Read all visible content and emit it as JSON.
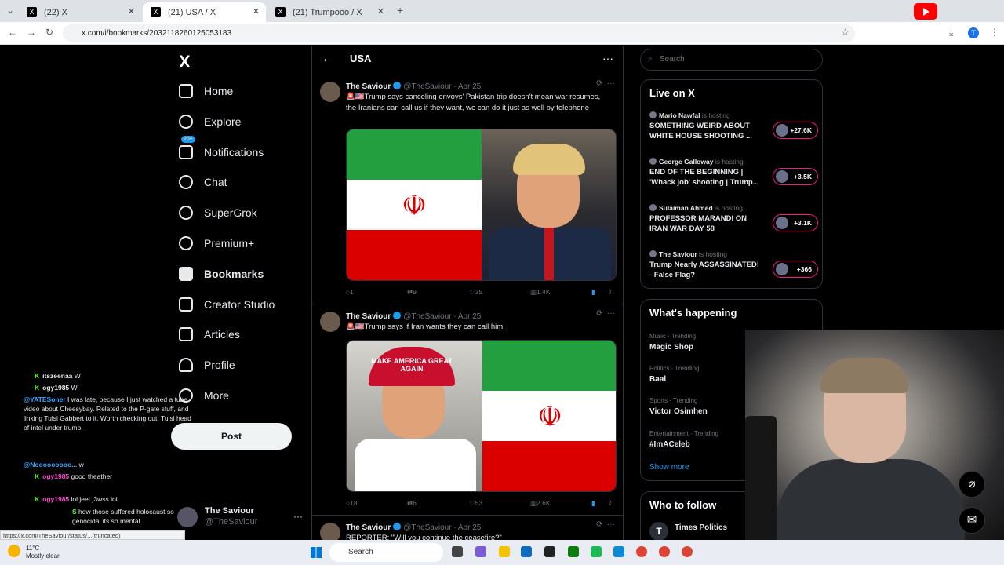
{
  "browser": {
    "tabs": [
      {
        "title": "(22) X"
      },
      {
        "title": "(21) USA / X"
      },
      {
        "title": "(21) Trumpooo / X"
      }
    ],
    "url": "x.com/i/bookmarks/2032118260125053183",
    "status_url": "https://x.com/TheSaviour/status/...(truncated)"
  },
  "sidebar": {
    "logo": "X",
    "items": [
      {
        "label": "Home"
      },
      {
        "label": "Explore"
      },
      {
        "label": "Notifications",
        "badge": "20+"
      },
      {
        "label": "Chat"
      },
      {
        "label": "SuperGrok"
      },
      {
        "label": "Premium+"
      },
      {
        "label": "Bookmarks"
      },
      {
        "label": "Creator Studio"
      },
      {
        "label": "Articles"
      },
      {
        "label": "Profile"
      },
      {
        "label": "More"
      }
    ],
    "post_label": "Post",
    "account": {
      "name": "The Saviour",
      "handle": "@TheSaviour"
    }
  },
  "feed": {
    "title": "USA",
    "tweets": [
      {
        "name": "The Saviour",
        "handle": "@TheSaviour",
        "date": "Apr 25",
        "text": "🚨🇺🇸Trump says canceling envoys' Pakistan trip doesn't mean war resumes, the Iranians can call us if they want, we can do it just as well by telephone",
        "replies": "1",
        "reposts": "9",
        "likes": "35",
        "views": "1.4K"
      },
      {
        "name": "The Saviour",
        "handle": "@TheSaviour",
        "date": "Apr 25",
        "text": "🚨🇺🇸Trump says if Iran wants they can call him.",
        "cap_text": "MAKE AMERICA GREAT AGAIN",
        "replies": "18",
        "reposts": "6",
        "likes": "53",
        "views": "2.6K"
      },
      {
        "name": "The Saviour",
        "handle": "@TheSaviour",
        "date": "Apr 25",
        "text": "REPORTER: \"Will you continue the ceasefire?\""
      }
    ]
  },
  "right": {
    "search_placeholder": "Search",
    "live_title": "Live on X",
    "hosting_label": "is hosting",
    "live": [
      {
        "host": "Mario Nawfal",
        "title": "SOMETHING WEIRD ABOUT WHITE HOUSE SHOOTING ...",
        "count": "+27.6K"
      },
      {
        "host": "George Galloway",
        "title": "END OF THE BEGINNING | 'Whack job' shooting | Trump...",
        "count": "+3.5K"
      },
      {
        "host": "Sulaiman Ahmed",
        "title": "PROFESSOR MARANDI ON IRAN WAR DAY 58",
        "count": "+3.1K"
      },
      {
        "host": "The Saviour",
        "title": "Trump Nearly ASSASSINATED! - False Flag?",
        "count": "+366"
      }
    ],
    "happening_title": "What's happening",
    "trends": [
      {
        "category": "Music · Trending",
        "name": "Magic Shop"
      },
      {
        "category": "Politics · Trending",
        "name": "Baal"
      },
      {
        "category": "Sports · Trending",
        "name": "Victor Osimhen"
      },
      {
        "category": "Entertainment · Trending",
        "name": "#ImACeleb"
      }
    ],
    "show_more": "Show more",
    "follow_title": "Who to follow",
    "follow": [
      {
        "name": "Times Politics",
        "initial": "T"
      }
    ]
  },
  "chat": [
    {
      "user": "itszeenaa",
      "msg": "W"
    },
    {
      "user": "ogy1985",
      "msg": "W"
    },
    {
      "user": "@YATESoner",
      "msg": "I was late, because I just watched a tube video about Cheesybay. Related to the P-gate stuff, and linking Tulsi Gabbert to it. Worth checking out. Tulsi head of intel under trump."
    },
    {
      "user": "@Nooooooooo...",
      "msg": "w"
    },
    {
      "user": "ogy1985",
      "msg": "good theather"
    },
    {
      "user": "ogy1985",
      "msg": "lol jeet j3wss lol"
    },
    {
      "user": "S",
      "msg": "how those suffered holocaust so genocidal its so mental"
    }
  ],
  "taskbar": {
    "temp": "11°C",
    "weather": "Mostly clear",
    "search": "Search"
  },
  "colors": {
    "accent": "#1d9bf0",
    "live_pink": "#f91880",
    "iran_green": "#239f40",
    "iran_red": "#da0000"
  }
}
